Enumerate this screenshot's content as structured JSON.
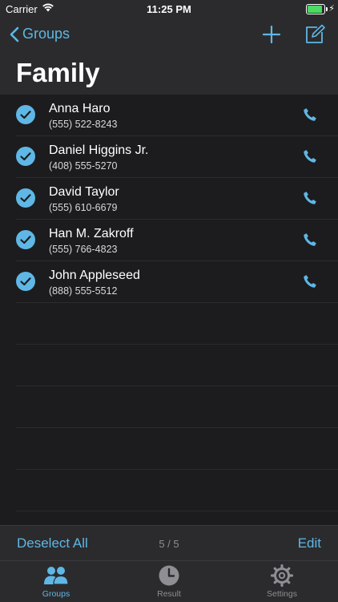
{
  "status_bar": {
    "carrier": "Carrier",
    "time": "11:25 PM",
    "battery_charging": true
  },
  "nav": {
    "back_label": "Groups",
    "title": "Family",
    "add_icon": "plus-icon",
    "compose_icon": "compose-icon"
  },
  "contacts": [
    {
      "name": "Anna Haro",
      "phone": "(555) 522-8243",
      "selected": true
    },
    {
      "name": "Daniel Higgins Jr.",
      "phone": "(408) 555-5270",
      "selected": true
    },
    {
      "name": "David Taylor",
      "phone": "(555) 610-6679",
      "selected": true
    },
    {
      "name": "Han M. Zakroff",
      "phone": "(555) 766-4823",
      "selected": true
    },
    {
      "name": "John Appleseed",
      "phone": "(888) 555-5512",
      "selected": true
    }
  ],
  "toolbar": {
    "deselect_label": "Deselect All",
    "count": "5 / 5",
    "edit_label": "Edit"
  },
  "tabs": [
    {
      "label": "Groups",
      "icon": "groups-icon",
      "active": true
    },
    {
      "label": "Result",
      "icon": "clock-icon",
      "active": false
    },
    {
      "label": "Settings",
      "icon": "gear-icon",
      "active": false
    }
  ],
  "colors": {
    "accent": "#5fb7e5",
    "background": "#1c1c1e",
    "bar": "#2b2b2d",
    "battery": "#4cd964"
  }
}
